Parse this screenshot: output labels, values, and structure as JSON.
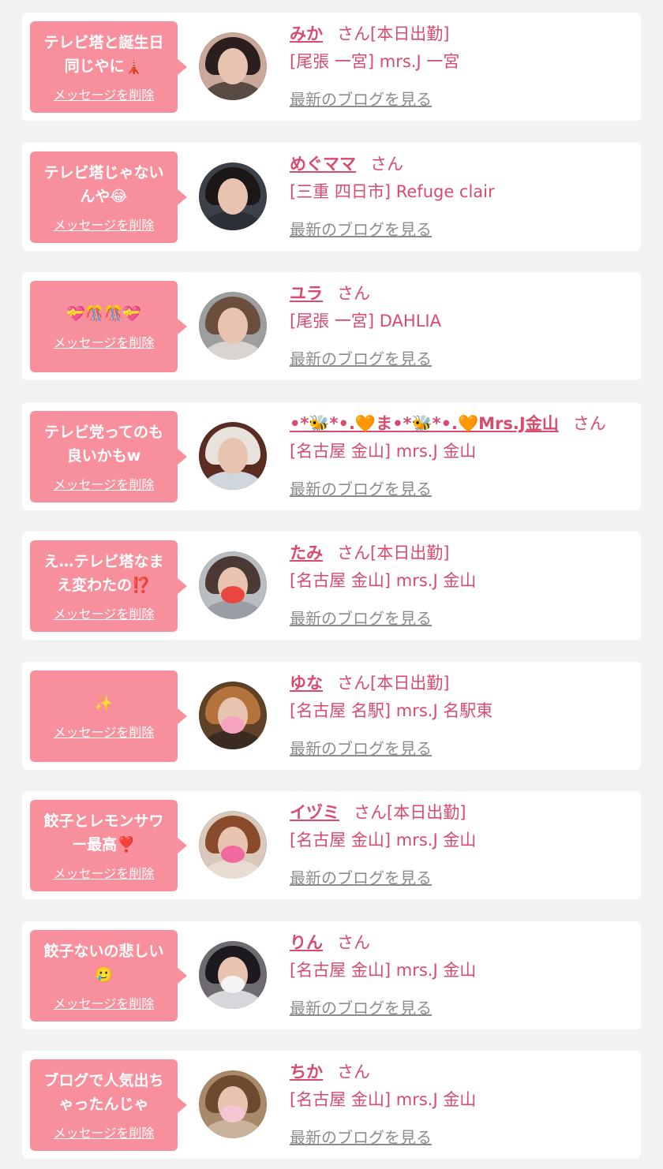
{
  "common": {
    "delete_label": "メッセージを削除",
    "san_label": "さん",
    "blog_label": "最新のブログを見る"
  },
  "items": [
    {
      "message": "テレビ塔と誕生日同じやに🗼",
      "name": "みか",
      "status": "[本日出勤]",
      "shop": "[尾張 一宮] mrs.J 一宮",
      "avatar": {
        "bg": "#c9a89a",
        "hair": "#2a1f1c",
        "body": "#5a4a44",
        "mask": ""
      }
    },
    {
      "message": "テレビ塔じゃないんや😂",
      "name": "めぐママ",
      "status": "",
      "shop": "[三重 四日市] Refuge clair",
      "avatar": {
        "bg": "#3c4048",
        "hair": "#1b1716",
        "body": "#2d2f36",
        "mask": ""
      }
    },
    {
      "message": "💝🎊🎊💝",
      "name": "ユラ",
      "status": "",
      "shop": "[尾張 一宮] DAHLIA",
      "avatar": {
        "bg": "#9d9f9e",
        "hair": "#6b4e3d",
        "body": "#d8d4cf",
        "mask": ""
      }
    },
    {
      "message": "テレビ党ってのも良いかもw",
      "name": "•*🐝*•.🧡ま•*🐝*•.🧡Mrs.J金山",
      "status": "",
      "shop": "[名古屋 金山] mrs.J 金山",
      "avatar": {
        "bg": "#5a2c22",
        "hair": "#e7e3dc",
        "body": "#cfd6dd",
        "mask": ""
      }
    },
    {
      "message": "え…テレビ塔なまえ変わたの⁉️",
      "name": "たみ",
      "status": "[本日出勤]",
      "shop": "[名古屋 金山] mrs.J 金山",
      "avatar": {
        "bg": "#b9bcc0",
        "hair": "#4a3a33",
        "body": "#9a9ea4",
        "mask": "#e8463f"
      }
    },
    {
      "message": "✨",
      "name": "ゆな",
      "status": "[本日出勤]",
      "shop": "[名古屋 名駅] mrs.J 名駅東",
      "avatar": {
        "bg": "#5e4126",
        "hair": "#b3733a",
        "body": "#3a2a20",
        "mask": "#f5a3c0"
      }
    },
    {
      "message": "餃子とレモンサワー最高❣️",
      "name": "イヅミ",
      "status": "[本日出勤]",
      "shop": "[名古屋 金山] mrs.J 金山",
      "avatar": {
        "bg": "#d9c9bb",
        "hair": "#8a4a2c",
        "body": "#e9ddd2",
        "mask": "#f06aa0"
      }
    },
    {
      "message": "餃子ないの悲しい🥲",
      "name": "りん",
      "status": "",
      "shop": "[名古屋 金山] mrs.J 金山",
      "avatar": {
        "bg": "#6e6a70",
        "hair": "#1c1a1e",
        "body": "#d8d6da",
        "mask": "#f4f4f4"
      }
    },
    {
      "message": "ブログで人気出ちゃったんじゃ",
      "name": "ちか",
      "status": "",
      "shop": "[名古屋 金山] mrs.J 金山",
      "avatar": {
        "bg": "#a88a6a",
        "hair": "#6b4a30",
        "body": "#c9b29a",
        "mask": "#f7c6d4"
      }
    }
  ]
}
